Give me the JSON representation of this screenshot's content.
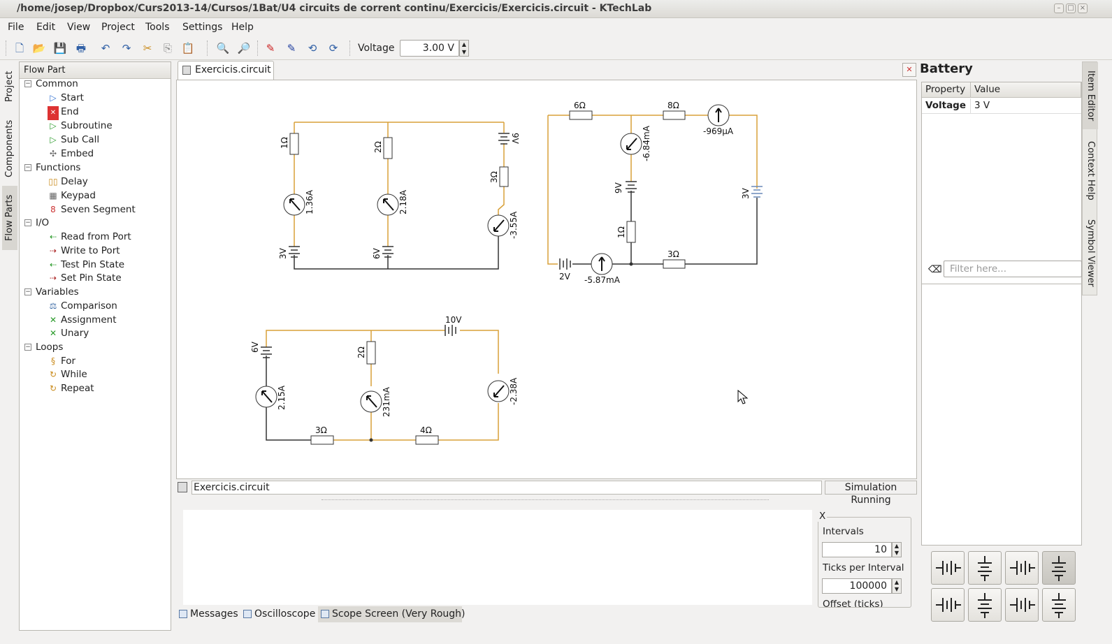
{
  "window": {
    "title": "/home/josep/Dropbox/Curs2013-14/Cursos/1Bat/U4 circuits de corrent continu/Exercicis/Exercicis.circuit - KTechLab"
  },
  "menu": [
    "File",
    "Edit",
    "View",
    "Project",
    "Tools",
    "Settings",
    "Help"
  ],
  "toolbar": {
    "voltage_label": "Voltage",
    "voltage_value": "3.00 V"
  },
  "left_tabs": [
    "Project",
    "Components",
    "Flow Parts"
  ],
  "flow_panel": {
    "header": "Flow Part",
    "groups": [
      {
        "label": "Common",
        "items": [
          "Start",
          "End",
          "Subroutine",
          "Sub Call",
          "Embed"
        ]
      },
      {
        "label": "Functions",
        "items": [
          "Delay",
          "Keypad",
          "Seven Segment"
        ]
      },
      {
        "label": "I/O",
        "items": [
          "Read from Port",
          "Write to Port",
          "Test Pin State",
          "Set Pin State"
        ]
      },
      {
        "label": "Variables",
        "items": [
          "Comparison",
          "Assignment",
          "Unary"
        ]
      },
      {
        "label": "Loops",
        "items": [
          "For",
          "While",
          "Repeat"
        ]
      }
    ]
  },
  "document": {
    "tab": "Exercicis.circuit",
    "status_file": "Exercicis.circuit",
    "status_state": "Simulation Running"
  },
  "circuit1": {
    "r1": "1Ω",
    "r2": "2Ω",
    "r3": "3Ω",
    "a1": "1.36A",
    "a2": "2.18A",
    "a3": "-3.55A",
    "b1": "3V",
    "b2": "6V",
    "b3": "9V"
  },
  "circuit2": {
    "r1": "6Ω",
    "r2": "8Ω",
    "r3": "1Ω",
    "r4": "3Ω",
    "a1": "-969µA",
    "a2": "-6.84mA",
    "a3": "-5.87mA",
    "b1": "9V",
    "b2": "3V",
    "b3": "2V"
  },
  "circuit3": {
    "b1": "10V",
    "b2": "6V",
    "r1": "2Ω",
    "r2": "3Ω",
    "r3": "4Ω",
    "a1": "2.15A",
    "a2": "231mA",
    "a3": "-2.38A"
  },
  "scope": {
    "group_title": "X",
    "intervals_label": "Intervals",
    "intervals_value": "10",
    "ticks_label": "Ticks per Interval",
    "ticks_value": "100000",
    "offset_label": "Offset (ticks)"
  },
  "bottom_tabs": [
    "Messages",
    "Oscilloscope",
    "Scope Screen (Very Rough)"
  ],
  "item_editor": {
    "title": "Battery",
    "col_property": "Property",
    "col_value": "Value",
    "prop_name": "Voltage",
    "prop_value": "3 V",
    "filter_placeholder": "Filter here..."
  },
  "right_tabs": [
    "Item Editor",
    "Context Help",
    "Symbol Viewer"
  ],
  "colors": {
    "wire_active": "#e0a020",
    "wire_idle": "#333333"
  }
}
